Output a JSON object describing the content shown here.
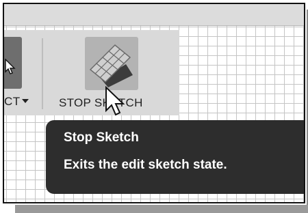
{
  "toolbar": {
    "previous_tool": {
      "label_fragment": "CT",
      "caret_icon": "caret-down-icon"
    },
    "stop_sketch": {
      "label": "STOP SKETCH",
      "icon": "stop-sketch-icon"
    }
  },
  "tooltip": {
    "title": "Stop Sketch",
    "description": "Exits the edit sketch state."
  },
  "colors": {
    "tooltip_bg": "#2d2d2d",
    "toolbar_bg": "#d9d9d9",
    "grid_line": "#c4c4c4"
  }
}
